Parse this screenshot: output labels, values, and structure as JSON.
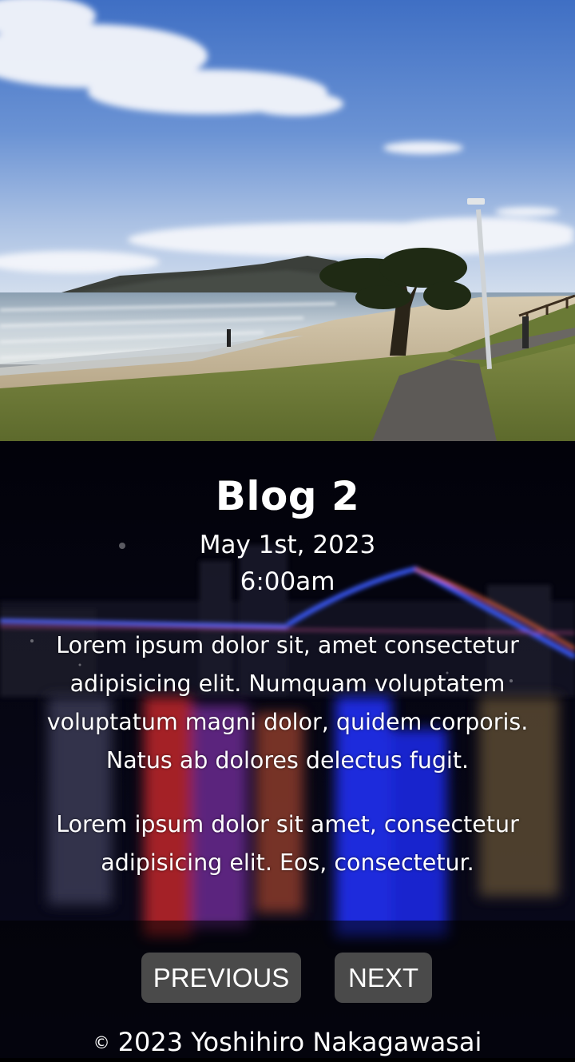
{
  "post": {
    "title": "Blog 2",
    "date": "May 1st, 2023",
    "time": "6:00am",
    "paragraphs": [
      "Lorem ipsum dolor sit, amet consectetur adipisicing elit. Numquam voluptatem voluptatum magni dolor, quidem corporis. Natus ab dolores delectus fugit.",
      "Lorem ipsum dolor sit amet, consectetur adipisicing elit. Eos, consectetur."
    ]
  },
  "nav": {
    "previous_label": "PREVIOUS",
    "next_label": "NEXT"
  },
  "footer": {
    "copyright_symbol": "©",
    "text": "2023 Yoshihiro Nakagawasai"
  },
  "colors": {
    "page_background": "#000000",
    "button_background": "#4a4a4a",
    "text": "#ffffff"
  }
}
